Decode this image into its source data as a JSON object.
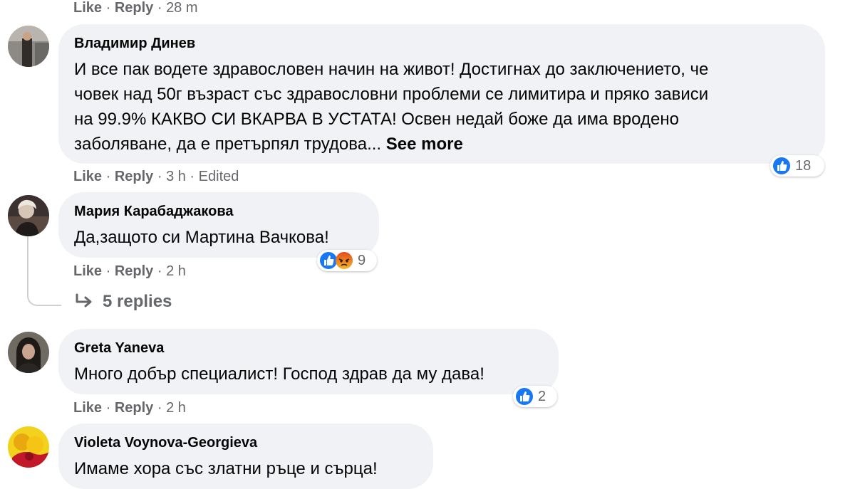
{
  "top_actions": {
    "like": "Like",
    "sep1": " · ",
    "reply": "Reply",
    "sep2": " · ",
    "time": "28 m"
  },
  "comments": [
    {
      "author": "Владимир Динев",
      "text": "И все пак водете здравословен начин на живот! Достигнах до заключението, че\nчовек над 50г възраст със здравословни проблеми се лимитира и пряко зависи\nна 99.9% КАКВО СИ ВКАРВА В УСТАТА! Освен недай боже да има вродено\nзаболяване, да е претърпял трудова...",
      "see_more": " See more",
      "like": "Like",
      "reply": "Reply",
      "time": "3 h",
      "edited": "Edited",
      "reaction_count": "18",
      "reaction_icons": [
        "like-icon"
      ],
      "colors": {
        "like": "#1877f2"
      }
    },
    {
      "author": "Мария Карабаджакова",
      "text": "Да,защото си Мартина Вачкова!",
      "like": "Like",
      "reply": "Reply",
      "time": "2 h",
      "reaction_count": "9",
      "reaction_icons": [
        "like-icon",
        "angry-icon"
      ],
      "replies_label": "5 replies",
      "colors": {
        "like": "#1877f2",
        "angry": "#e9710f"
      }
    },
    {
      "author": "Greta Yaneva",
      "text": "Много добър специалист! Господ здрав да му дава!",
      "like": "Like",
      "reply": "Reply",
      "time": "2 h",
      "reaction_count": "2",
      "reaction_icons": [
        "like-icon"
      ]
    },
    {
      "author": "Violeta Voynova-Georgieva",
      "text": "Имаме хора със златни ръце и сърца!"
    }
  ],
  "ui_colors": {
    "bubble": "#f0f2f5",
    "meta_text": "#65676b",
    "text": "#050505"
  }
}
